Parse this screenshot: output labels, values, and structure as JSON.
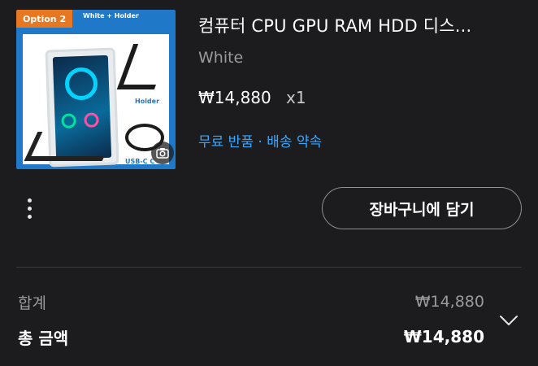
{
  "product": {
    "title": "컴퓨터 CPU GPU RAM HDD 디스...",
    "variant": "White",
    "price": "₩14,880",
    "quantity": "x1",
    "promo": "무료 반품 · 배송 약속",
    "image": {
      "option_badge": "Option 2",
      "option_subtitle": "White + Holder",
      "holder_label": "Holder",
      "cable_label": "USB-C C"
    }
  },
  "actions": {
    "add_to_cart_label": "장바구니에 담기",
    "more_icon": "more-vertical-icon",
    "camera_icon": "camera-icon",
    "expand_icon": "chevron-down-icon"
  },
  "summary": {
    "subtotal_label": "합계",
    "subtotal_value": "₩14,880",
    "total_label": "총 금액",
    "total_value": "₩14,880"
  },
  "colors": {
    "background": "#1c1c1e",
    "link": "#3aa7ff",
    "muted": "#9a9a9f",
    "divider": "#3a3a3c"
  }
}
